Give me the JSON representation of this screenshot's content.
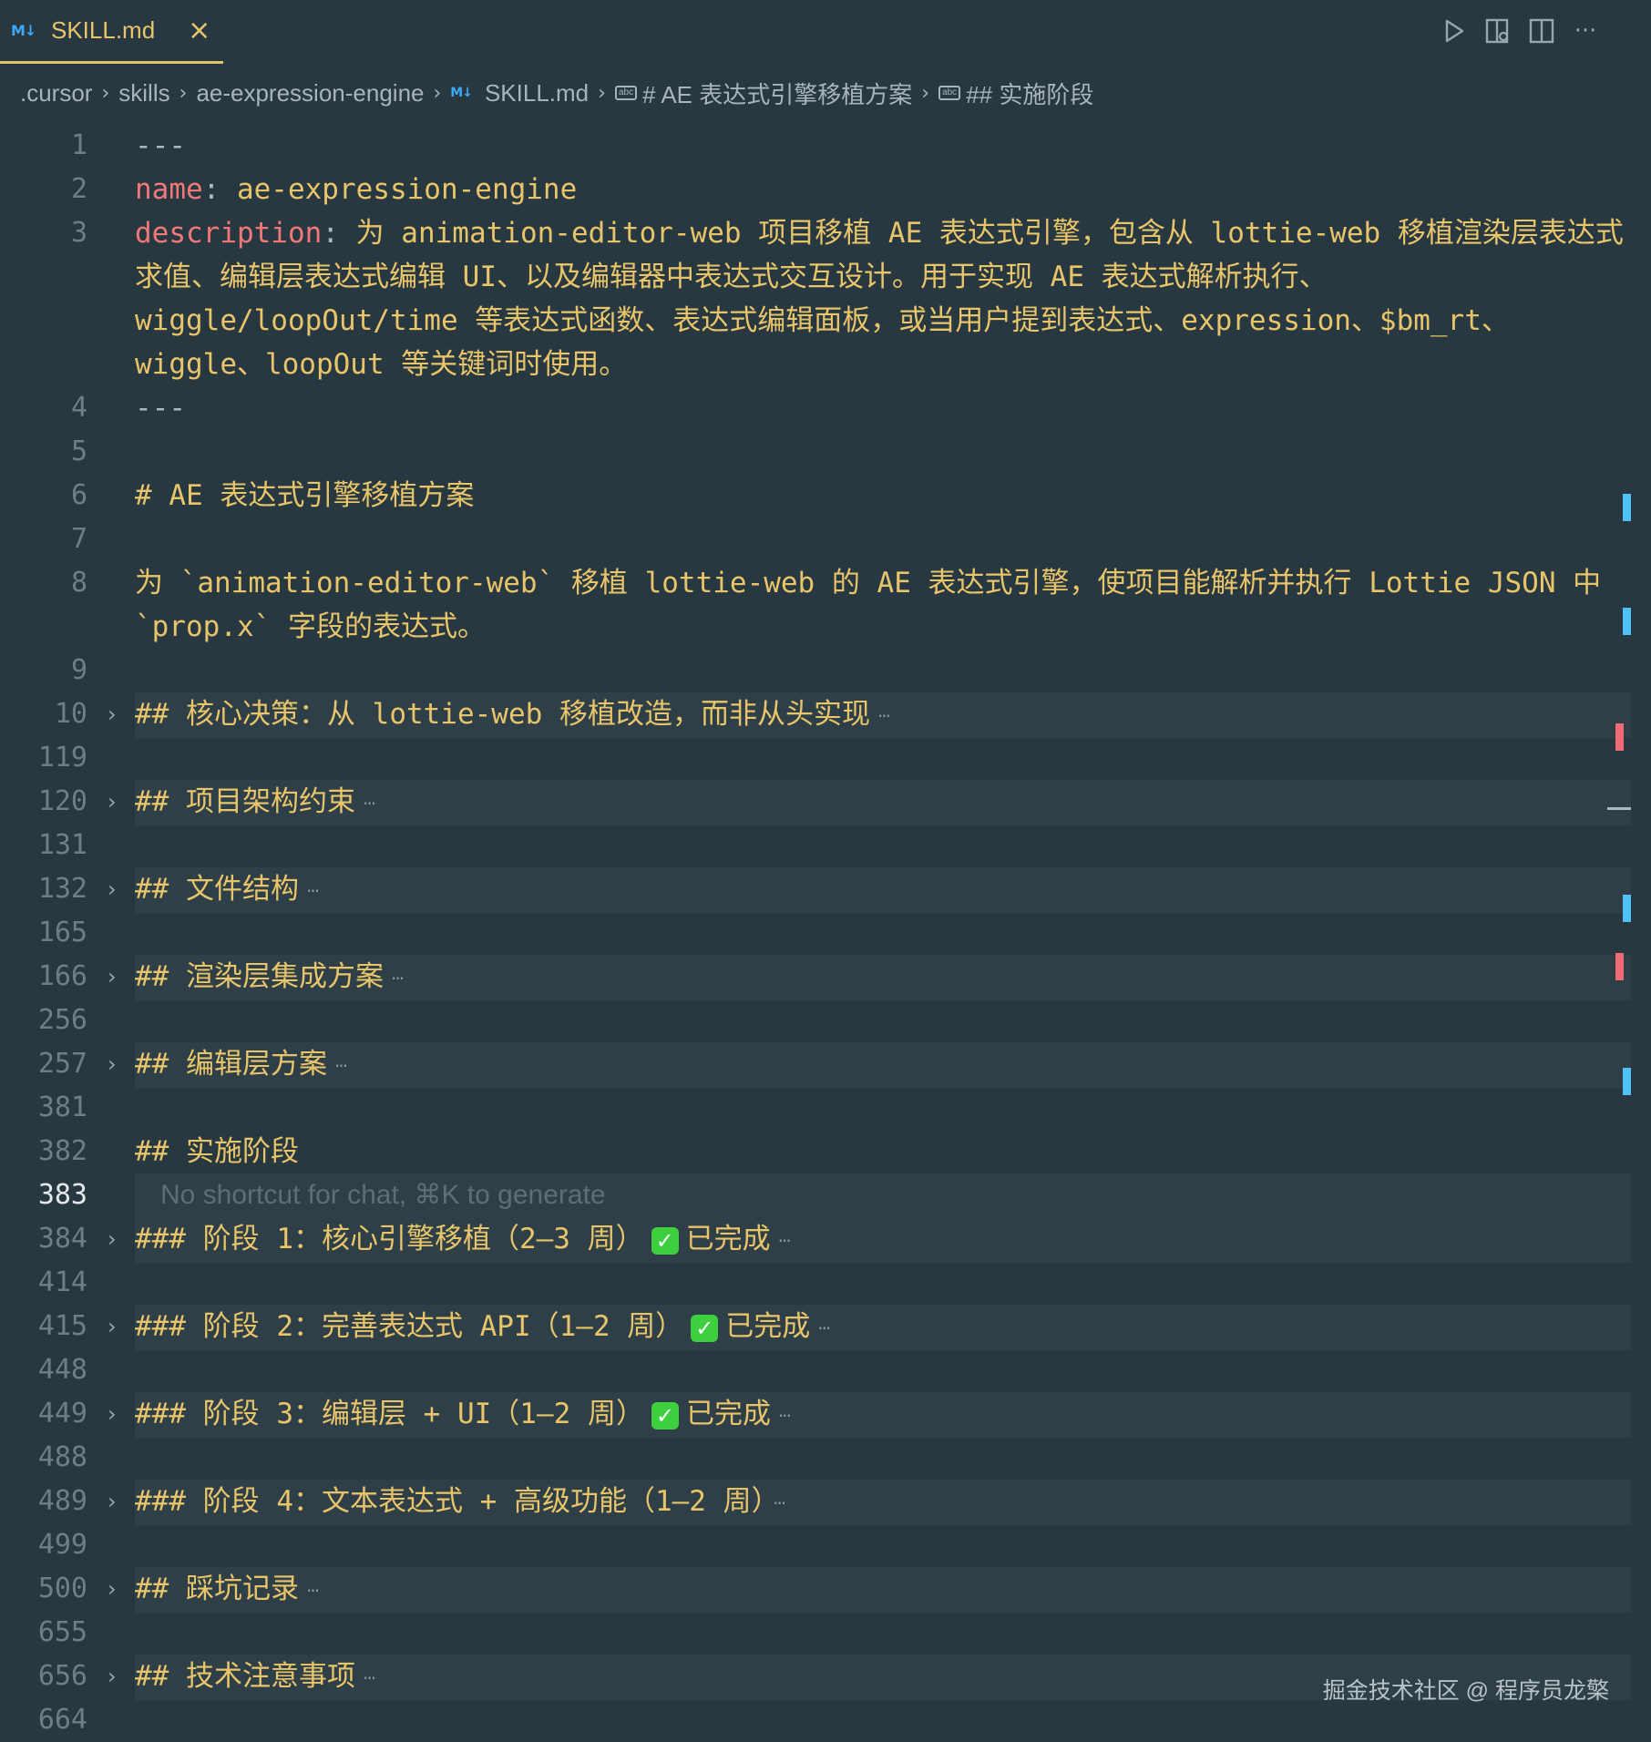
{
  "tab": {
    "icon": "markdown-icon",
    "name": "SKILL.md",
    "close": "×"
  },
  "actions": [
    "run-icon",
    "preview-icon",
    "split-editor-icon",
    "more-icon"
  ],
  "breadcrumb": [
    ".cursor",
    "skills",
    "ae-expression-engine",
    "SKILL.md",
    "# AE 表达式引擎移植方案",
    "## 实施阶段"
  ],
  "colors": {
    "background": "#283840",
    "heading": "#e8c46a",
    "key": "#f07878",
    "markers_blue": "#4fc3f7",
    "markers_red": "#f06b75"
  },
  "lines": [
    {
      "n": "1",
      "text": "---"
    },
    {
      "n": "2",
      "key": "name",
      "value": "ae-expression-engine"
    },
    {
      "n": "3",
      "key": "description",
      "value": "为 animation-editor-web 项目移植 AE 表达式引擎，包含从 lottie-web 移植渲染层表达式求值、编辑层表达式编辑 UI、以及编辑器中表达式交互设计。用于实现 AE 表达式解析执行、wiggle/loopOut/time 等表达式函数、表达式编辑面板，或当用户提到表达式、expression、$bm_rt、wiggle、loopOut 等关键词时使用。"
    },
    {
      "n": "4",
      "text": "---"
    },
    {
      "n": "5",
      "text": ""
    },
    {
      "n": "6",
      "text": "# AE 表达式引擎移植方案"
    },
    {
      "n": "7",
      "text": ""
    },
    {
      "n": "8",
      "text": "为 `animation-editor-web` 移植 lottie-web 的 AE 表达式引擎，使项目能解析并执行 Lottie JSON 中 `prop.x` 字段的表达式。"
    },
    {
      "n": "9",
      "text": ""
    },
    {
      "n": "10",
      "text": "## 核心决策：从 lottie-web 移植改造，而非从头实现",
      "folded": true
    },
    {
      "n": "119",
      "text": ""
    },
    {
      "n": "120",
      "text": "## 项目架构约束",
      "folded": true
    },
    {
      "n": "131",
      "text": ""
    },
    {
      "n": "132",
      "text": "## 文件结构",
      "folded": true
    },
    {
      "n": "165",
      "text": ""
    },
    {
      "n": "166",
      "text": "## 渲染层集成方案",
      "folded": true
    },
    {
      "n": "256",
      "text": ""
    },
    {
      "n": "257",
      "text": "## 编辑层方案",
      "folded": true
    },
    {
      "n": "381",
      "text": ""
    },
    {
      "n": "382",
      "text": "## 实施阶段"
    },
    {
      "n": "383",
      "ghost": "No shortcut for chat, ⌘K to generate"
    },
    {
      "n": "384",
      "text": "### 阶段 1：核心引擎移植（2–3 周）",
      "done": "已完成",
      "folded": true
    },
    {
      "n": "414",
      "text": ""
    },
    {
      "n": "415",
      "text": "### 阶段 2：完善表达式 API（1–2 周）",
      "done": "已完成",
      "folded": true
    },
    {
      "n": "448",
      "text": ""
    },
    {
      "n": "449",
      "text": "### 阶段 3：编辑层 + UI（1–2 周）",
      "done": "已完成",
      "folded": true
    },
    {
      "n": "488",
      "text": ""
    },
    {
      "n": "489",
      "text": "### 阶段 4：文本表达式 + 高级功能（1–2 周）",
      "folded": true
    },
    {
      "n": "499",
      "text": ""
    },
    {
      "n": "500",
      "text": "## 踩坑记录",
      "folded": true
    },
    {
      "n": "655",
      "text": ""
    },
    {
      "n": "656",
      "text": "## 技术注意事项",
      "folded": true
    },
    {
      "n": "664",
      "text": ""
    }
  ],
  "watermark": "掘金技术社区 @ 程序员龙檠"
}
